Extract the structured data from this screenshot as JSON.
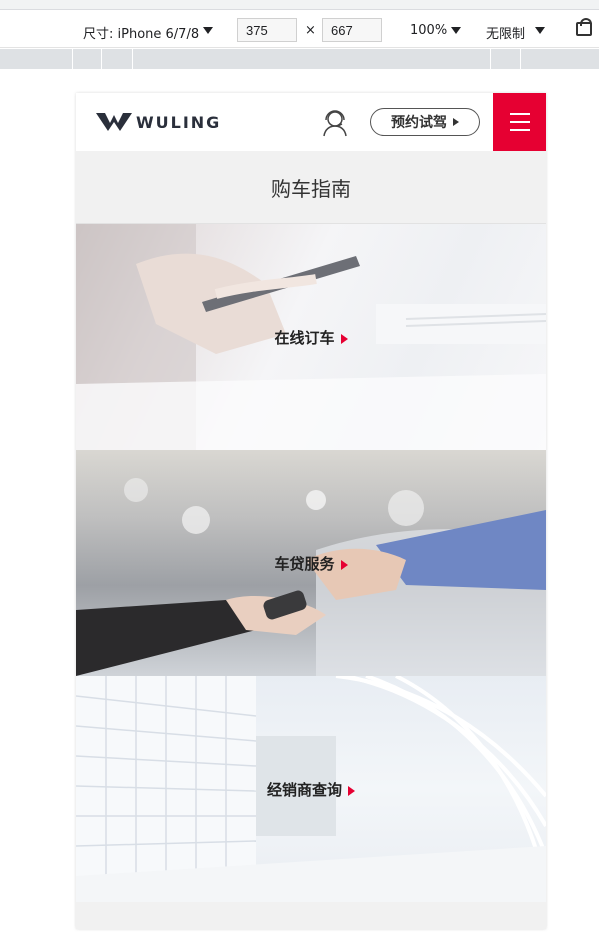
{
  "devtools": {
    "device_label": "尺寸: iPhone 6/7/8",
    "width_value": "375",
    "times": "×",
    "height_value": "667",
    "zoom": "100%",
    "throttle": "无限制"
  },
  "header": {
    "logo_text": "WULING",
    "testdrive_label": "预约试驾"
  },
  "page_title": "购车指南",
  "cards": [
    {
      "label": "在线订车"
    },
    {
      "label": "车贷服务"
    },
    {
      "label": "经销商查询"
    }
  ],
  "colors": {
    "accent": "#e60032",
    "title_bg": "#f1f1f1"
  }
}
